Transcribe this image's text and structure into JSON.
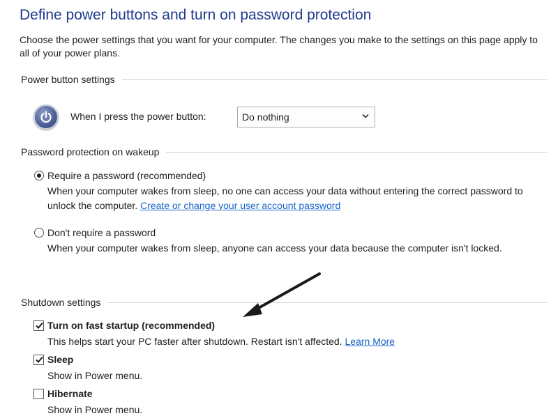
{
  "header": {
    "title": "Define power buttons and turn on password protection",
    "intro": "Choose the power settings that you want for your computer. The changes you make to the settings on this page apply to all of your power plans."
  },
  "power_button_settings": {
    "section_label": "Power button settings",
    "icon": "power-icon",
    "label": "When I press the power button:",
    "selected_value": "Do nothing"
  },
  "password_protection": {
    "section_label": "Password protection on wakeup",
    "options": [
      {
        "label": "Require a password (recommended)",
        "checked": true,
        "description": "When your computer wakes from sleep, no one can access your data without entering the correct password to unlock the computer.",
        "link": "Create or change your user account password"
      },
      {
        "label": "Don't require a password",
        "checked": false,
        "description": "When your computer wakes from sleep, anyone can access your data because the computer isn't locked."
      }
    ]
  },
  "shutdown_settings": {
    "section_label": "Shutdown settings",
    "items": [
      {
        "label": "Turn on fast startup (recommended)",
        "checked": true,
        "description": "This helps start your PC faster after shutdown. Restart isn't affected.",
        "link": "Learn More"
      },
      {
        "label": "Sleep",
        "checked": true,
        "description": "Show in Power menu."
      },
      {
        "label": "Hibernate",
        "checked": false,
        "description": "Show in Power menu."
      }
    ]
  },
  "colors": {
    "title": "#1e3a8c",
    "link": "#1a63c7"
  }
}
